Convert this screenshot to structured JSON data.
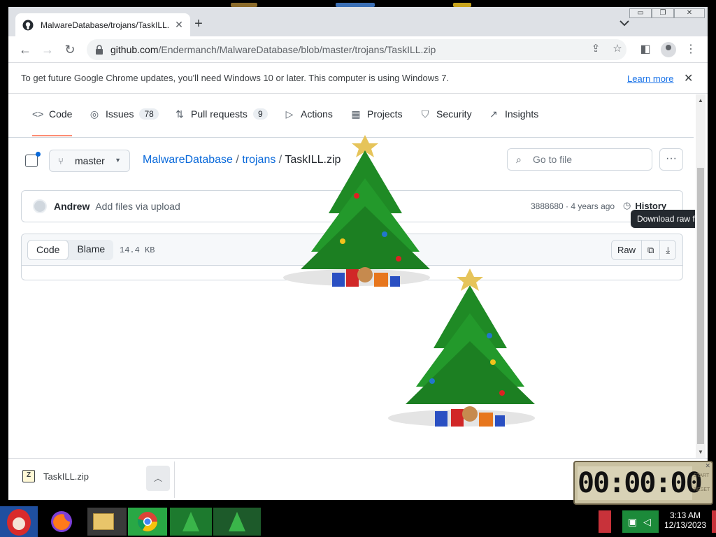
{
  "browser": {
    "tab_title": "MalwareDatabase/trojans/TaskILL.zip",
    "new_tab_label": "+",
    "url_host": "github.com",
    "url_path": "/Endermanch/MalwareDatabase/blob/master/trojans/TaskILL.zip",
    "window_controls": [
      "▭",
      "❐",
      "✕"
    ]
  },
  "infobar": {
    "message": "To get future Google Chrome updates, you'll need Windows 10 or later. This computer is using Windows 7.",
    "link": "Learn more"
  },
  "repo_nav": {
    "tabs": [
      {
        "label": "Code",
        "icon": "code-icon",
        "glyph": "<>"
      },
      {
        "label": "Issues",
        "icon": "issue-icon",
        "glyph": "◎",
        "count": "78"
      },
      {
        "label": "Pull requests",
        "icon": "pull-request-icon",
        "glyph": "⇅",
        "count": "9"
      },
      {
        "label": "Actions",
        "icon": "play-icon",
        "glyph": "▷"
      },
      {
        "label": "Projects",
        "icon": "table-icon",
        "glyph": "▦"
      },
      {
        "label": "Security",
        "icon": "shield-icon",
        "glyph": "⛉"
      },
      {
        "label": "Insights",
        "icon": "graph-icon",
        "glyph": "↗"
      }
    ]
  },
  "file_nav": {
    "branch": "master",
    "breadcrumb_repo": "MalwareDatabase",
    "breadcrumb_dir": "trojans",
    "breadcrumb_file": "TaskILL.zip",
    "separator": "/",
    "go_to_file_placeholder": "Go to file"
  },
  "commit": {
    "author": "Andrew",
    "message": "Add files via upload",
    "meta": "3888680 · 4 years ago",
    "history_label": "History"
  },
  "file_view": {
    "code_label": "Code",
    "blame_label": "Blame",
    "size": "14.4 KB",
    "raw_label": "Raw",
    "tooltip": "Download raw fil"
  },
  "download_bar": {
    "filename": "TaskILL.zip"
  },
  "timer": {
    "display": "00:00:00",
    "side_top": "START",
    "side_bottom": "RESET"
  },
  "taskbar": {
    "time": "3:13 AM",
    "date": "12/13/2023"
  },
  "colors": {
    "accent": "#0969da",
    "active_tab_underline": "#fd8c73",
    "chrome_frame": "#dee1e6"
  }
}
